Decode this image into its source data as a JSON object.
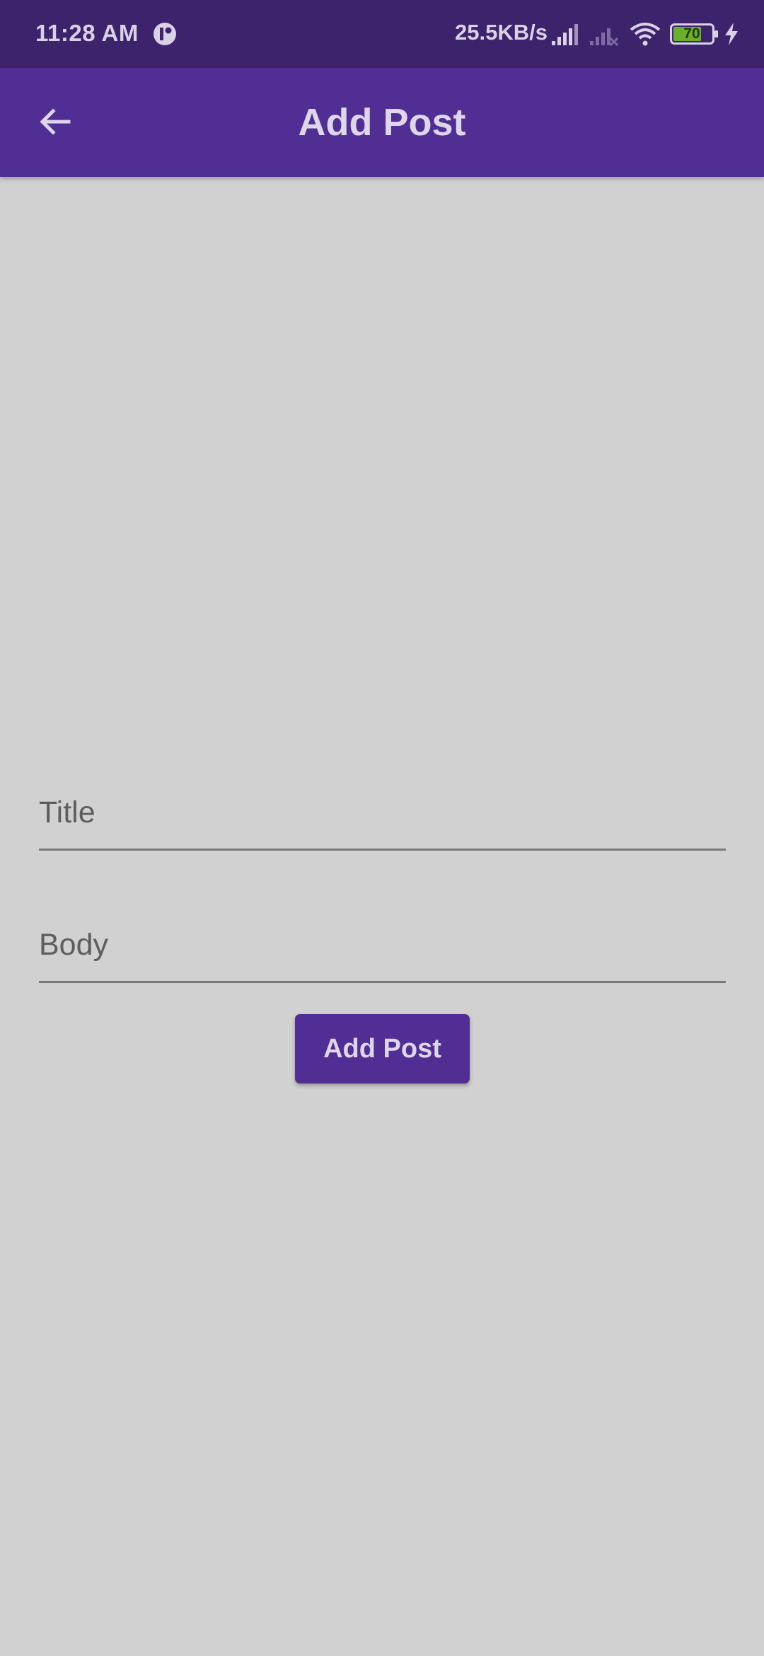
{
  "status_bar": {
    "time": "11:28 AM",
    "network_speed": "25.5KB/s",
    "battery_level": "70",
    "icons": [
      "app-notification-icon",
      "signal-icon",
      "signal-no-service-icon",
      "wifi-icon",
      "battery-icon",
      "charging-icon"
    ]
  },
  "app_bar": {
    "title": "Add Post",
    "back_icon": "arrow-back-icon"
  },
  "form": {
    "title_placeholder": "Title",
    "title_value": "",
    "body_placeholder": "Body",
    "body_value": "",
    "submit_label": "Add Post"
  },
  "colors": {
    "status_bar": "#3d226c",
    "app_bar": "#512e93",
    "background": "#d1d1d1",
    "button": "#512e93",
    "on_primary": "#ded6ea",
    "battery_fill": "#6bb02a"
  }
}
